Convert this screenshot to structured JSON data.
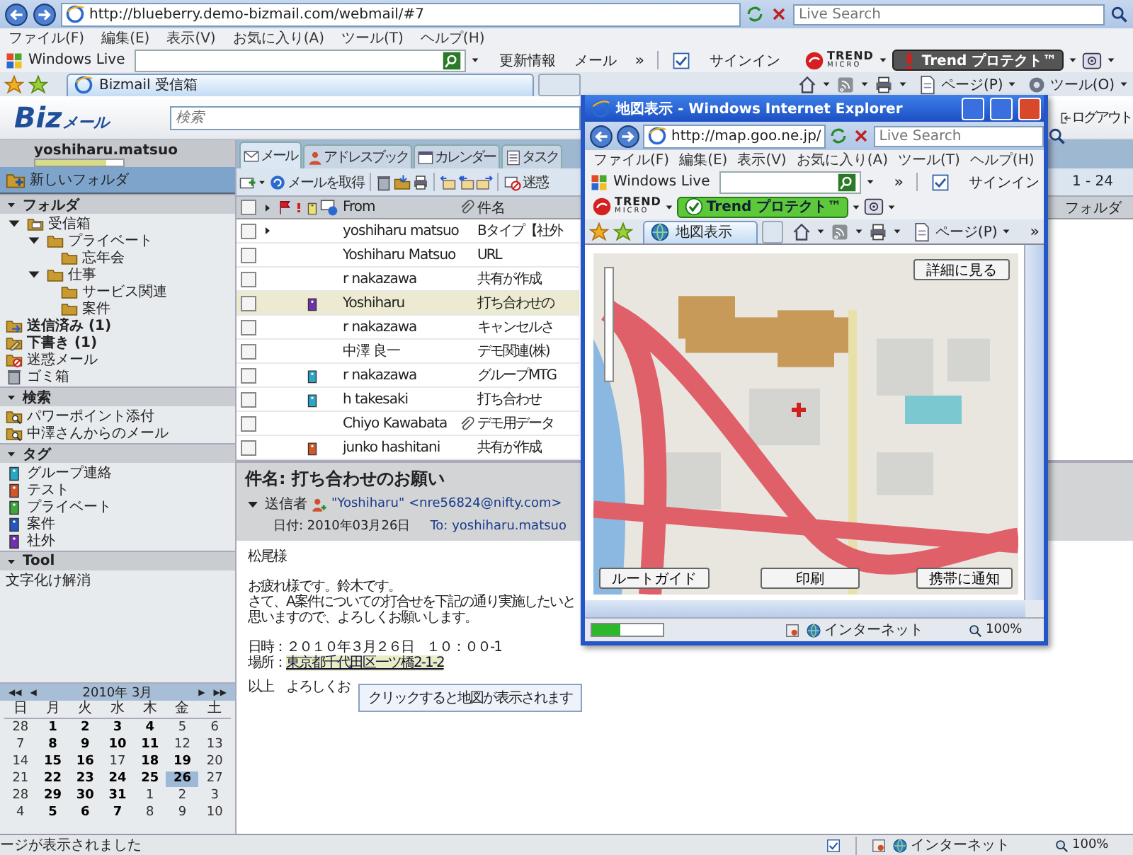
{
  "browser": {
    "address": "http://blueberry.demo-bizmail.com/webmail/#7",
    "search_placeholder": "Live Search",
    "menu": [
      "ファイル(F)",
      "編集(E)",
      "表示(V)",
      "お気に入り(A)",
      "ツール(T)",
      "ヘルプ(H)"
    ],
    "windows_live": "Windows Live",
    "links": [
      "更新情報",
      "メール"
    ],
    "chevron": "»",
    "signin": "サインイン",
    "trend_logo": "TREND",
    "trend_sub": "MICRO",
    "trend_button": "Trend プロテクト™",
    "tab": "Bizmail 受信箱",
    "commands": [
      "ページ(P)",
      "ツール(O)"
    ],
    "status": "ージが表示されました",
    "zone": "インターネット",
    "zoom": "100%"
  },
  "app": {
    "logo": "Biz",
    "logo_sub": "メール",
    "search_placeholder": "検索",
    "logout": "ログアウト"
  },
  "sidebar": {
    "user": "yoshiharu.matsuo",
    "quota": {
      "level": 0.8
    },
    "new_folder": "新しいフォルダ",
    "sections": [
      {
        "title": "フォルダ",
        "expanded": true,
        "items": [
          {
            "label": "受信箱",
            "kind": "inbox",
            "bold": false,
            "expanded": true,
            "children": [
              {
                "label": "プライベート",
                "kind": "folder",
                "bold": false,
                "expanded": true,
                "children": [
                  {
                    "label": "忘年会",
                    "kind": "folder",
                    "bold": false
                  }
                ]
              },
              {
                "label": "仕事",
                "kind": "folder",
                "bold": false,
                "expanded": true,
                "children": [
                  {
                    "label": "サービス関連",
                    "kind": "folder",
                    "bold": false
                  },
                  {
                    "label": "案件",
                    "kind": "folder",
                    "bold": false
                  }
                ]
              }
            ]
          },
          {
            "label": "送信済み (1)",
            "kind": "sent",
            "bold": true
          },
          {
            "label": "下書き (1)",
            "kind": "draft",
            "bold": true
          },
          {
            "label": "迷惑メール",
            "kind": "spam",
            "bold": false
          },
          {
            "label": "ゴミ箱",
            "kind": "trash",
            "bold": false
          }
        ]
      },
      {
        "title": "検索",
        "expanded": true,
        "items": [
          {
            "label": "パワーポイント添付",
            "kind": "search"
          },
          {
            "label": "中澤さんからのメール",
            "kind": "search"
          }
        ]
      },
      {
        "title": "タグ",
        "expanded": true,
        "items": [
          {
            "label": "グループ連絡",
            "kind": "tag",
            "color": "#2aa6c6"
          },
          {
            "label": "テスト",
            "kind": "tag",
            "color": "#d0582a"
          },
          {
            "label": "プライベート",
            "kind": "tag",
            "color": "#3aa83a"
          },
          {
            "label": "案件",
            "kind": "tag",
            "color": "#2058c0"
          },
          {
            "label": "社外",
            "kind": "tag",
            "color": "#7030b0"
          }
        ]
      },
      {
        "title": "Tool",
        "expanded": true,
        "items": [
          {
            "label": "文字化け解消",
            "kind": "plain"
          }
        ]
      }
    ]
  },
  "calendar": {
    "title": "2010年 3月",
    "nav": [
      "◀◀",
      "◀",
      "▶",
      "▶▶"
    ],
    "weekdays": [
      "日",
      "月",
      "火",
      "水",
      "木",
      "金",
      "土"
    ],
    "weeks": [
      [
        {
          "d": "28",
          "bold": false,
          "selected": false
        },
        {
          "d": "1",
          "bold": true,
          "selected": false
        },
        {
          "d": "2",
          "bold": true,
          "selected": false
        },
        {
          "d": "3",
          "bold": true,
          "selected": false
        },
        {
          "d": "4",
          "bold": true,
          "selected": false
        },
        {
          "d": "5",
          "bold": false,
          "selected": false
        },
        {
          "d": "6",
          "bold": false,
          "selected": false
        }
      ],
      [
        {
          "d": "7",
          "bold": false,
          "selected": false
        },
        {
          "d": "8",
          "bold": true,
          "selected": false
        },
        {
          "d": "9",
          "bold": true,
          "selected": false
        },
        {
          "d": "10",
          "bold": true,
          "selected": false
        },
        {
          "d": "11",
          "bold": true,
          "selected": false
        },
        {
          "d": "12",
          "bold": false,
          "selected": false
        },
        {
          "d": "13",
          "bold": false,
          "selected": false
        }
      ],
      [
        {
          "d": "14",
          "bold": false,
          "selected": false
        },
        {
          "d": "15",
          "bold": true,
          "selected": false
        },
        {
          "d": "16",
          "bold": true,
          "selected": false
        },
        {
          "d": "17",
          "bold": false,
          "selected": false
        },
        {
          "d": "18",
          "bold": true,
          "selected": false
        },
        {
          "d": "19",
          "bold": true,
          "selected": false
        },
        {
          "d": "20",
          "bold": false,
          "selected": false
        }
      ],
      [
        {
          "d": "21",
          "bold": false,
          "selected": false
        },
        {
          "d": "22",
          "bold": true,
          "selected": false
        },
        {
          "d": "23",
          "bold": true,
          "selected": false
        },
        {
          "d": "24",
          "bold": true,
          "selected": false
        },
        {
          "d": "25",
          "bold": true,
          "selected": false
        },
        {
          "d": "26",
          "bold": true,
          "selected": true
        },
        {
          "d": "27",
          "bold": false,
          "selected": false
        }
      ],
      [
        {
          "d": "28",
          "bold": false,
          "selected": false
        },
        {
          "d": "29",
          "bold": true,
          "selected": false
        },
        {
          "d": "30",
          "bold": true,
          "selected": false
        },
        {
          "d": "31",
          "bold": true,
          "selected": false
        },
        {
          "d": "1",
          "bold": false,
          "selected": false
        },
        {
          "d": "2",
          "bold": false,
          "selected": false
        },
        {
          "d": "3",
          "bold": false,
          "selected": false
        }
      ],
      [
        {
          "d": "4",
          "bold": false,
          "selected": false
        },
        {
          "d": "5",
          "bold": true,
          "selected": false
        },
        {
          "d": "6",
          "bold": true,
          "selected": false
        },
        {
          "d": "7",
          "bold": true,
          "selected": false
        },
        {
          "d": "8",
          "bold": false,
          "selected": false
        },
        {
          "d": "9",
          "bold": false,
          "selected": false
        },
        {
          "d": "10",
          "bold": false,
          "selected": false
        }
      ]
    ]
  },
  "mail": {
    "tabs": [
      {
        "label": "メール",
        "kind": "mail",
        "selected": true
      },
      {
        "label": "アドレスブック",
        "kind": "person",
        "selected": false
      },
      {
        "label": "カレンダー",
        "kind": "calendar",
        "selected": false
      },
      {
        "label": "タスク",
        "kind": "task",
        "selected": false
      }
    ],
    "get_mail": "メールを取得",
    "spam": "迷惑",
    "pager": "1 - 24",
    "folder_column": "フォルダ",
    "select_all": {
      "checked": false
    },
    "columns": {
      "from": "From",
      "subject": "件名"
    },
    "rows": [
      {
        "from": "yoshiharu matsuo",
        "subject": "Bタイプ【社外",
        "thread": true,
        "color": null,
        "attachment": false,
        "selected": false,
        "checked": false
      },
      {
        "from": "Yoshiharu Matsuo",
        "subject": "URL",
        "thread": false,
        "color": null,
        "attachment": false,
        "selected": false,
        "checked": false
      },
      {
        "from": "r nakazawa",
        "subject": "共有が作成",
        "thread": false,
        "color": null,
        "attachment": false,
        "selected": false,
        "checked": false
      },
      {
        "from": "Yoshiharu",
        "subject": "打ち合わせの",
        "thread": false,
        "color": "#7030b0",
        "attachment": false,
        "selected": true,
        "checked": false
      },
      {
        "from": "r nakazawa",
        "subject": "キャンセルさ",
        "thread": false,
        "color": null,
        "attachment": false,
        "selected": false,
        "checked": false
      },
      {
        "from": "中澤 良一",
        "subject": "デモ関連(株)",
        "thread": false,
        "color": null,
        "attachment": false,
        "selected": false,
        "checked": false
      },
      {
        "from": "r nakazawa",
        "subject": "グループMTG",
        "thread": false,
        "color": "#2aa6c6",
        "attachment": false,
        "selected": false,
        "checked": false
      },
      {
        "from": "h takesaki",
        "subject": "打ち合わせ",
        "thread": false,
        "color": "#2aa6c6",
        "attachment": false,
        "selected": false,
        "checked": false
      },
      {
        "from": "Chiyo Kawabata",
        "subject": "デモ用データ",
        "thread": false,
        "color": null,
        "attachment": true,
        "selected": false,
        "checked": false
      },
      {
        "from": "junko hashitani",
        "subject": "共有が作成",
        "thread": false,
        "color": "#d0582a",
        "attachment": false,
        "selected": false,
        "checked": false
      }
    ]
  },
  "message": {
    "subject": "件名: 打ち合わせのお願い",
    "sender_label": "送信者",
    "sender": "\"Yoshiharu\" <nre56824@nifty.com>",
    "date": "日付: 2010年03月26日",
    "to": "To: yoshiharu.matsuo",
    "paragraphs": [
      [
        "松尾様"
      ],
      [
        "お疲れ様です。鈴木です。",
        "さて、A案件についての打合せを下記の通り実施したいと",
        "思いますので、よろしくお願いします。"
      ],
      [
        "日時：２０１０年３月２６日　１０：００-1"
      ]
    ],
    "location_label": "場所：",
    "location": "東京都千代田区一ツ橋2-1-2",
    "closing": "以上　よろしくお",
    "tooltip": "クリックすると地図が表示されます"
  },
  "popup": {
    "title": "地図表示 - Windows Internet Explorer",
    "address": "http://map.goo.ne.jp/",
    "search_placeholder": "Live Search",
    "menu": [
      "ファイル(F)",
      "編集(E)",
      "表示(V)",
      "お気に入り(A)",
      "ツール(T)",
      "ヘルプ(H)"
    ],
    "windows_live": "Windows Live",
    "chevron": "»",
    "signin": "サインイン",
    "trend_logo": "TREND",
    "trend_sub": "MICRO",
    "trend_button": "Trend プロテクト™",
    "tab": "地図表示",
    "commands": [
      "ページ(P)"
    ],
    "map_buttons": [
      "詳細に見る",
      "ルートガイド",
      "印刷",
      "携帯に通知"
    ],
    "zone": "インターネット",
    "zoom": "100%"
  }
}
